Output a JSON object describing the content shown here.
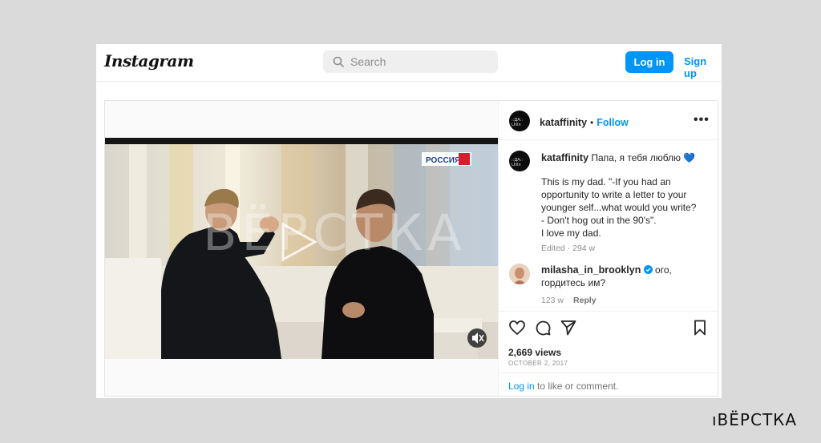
{
  "header": {
    "logo": "Instagram",
    "search_placeholder": "Search",
    "login_label": "Log in",
    "signup_label": "Sign up"
  },
  "video": {
    "channel_logo": "РОССИЯ 1",
    "watermark": "ВЁРСТКА"
  },
  "post": {
    "author": "kataffinity",
    "follow_label": "Follow",
    "dot": "•",
    "more": "•••",
    "caption_first": "Папа, я тебя люблю 💙",
    "caption_lines": [
      "This is my dad. \"-If you had an",
      "opportunity to write a letter to your",
      "younger self...what would you write?",
      "- Don't hog out in the 90's\".",
      "I love my dad."
    ],
    "caption_meta": "Edited · 294 w"
  },
  "comments": [
    {
      "user": "milasha_in_brooklyn",
      "text_first": "ого,",
      "text_second": "гордитесь им?",
      "age": "123 w",
      "reply_label": "Reply"
    }
  ],
  "stats": {
    "views": "2,669 views",
    "date": "OCTOBER 2, 2017"
  },
  "footer": {
    "login_link": "Log in",
    "login_rest": " to like or comment."
  },
  "brand": "ıВЁРСТКА",
  "colors": {
    "accent": "#0095f6",
    "page_bg": "#dadada",
    "verified": "#0095f6"
  }
}
